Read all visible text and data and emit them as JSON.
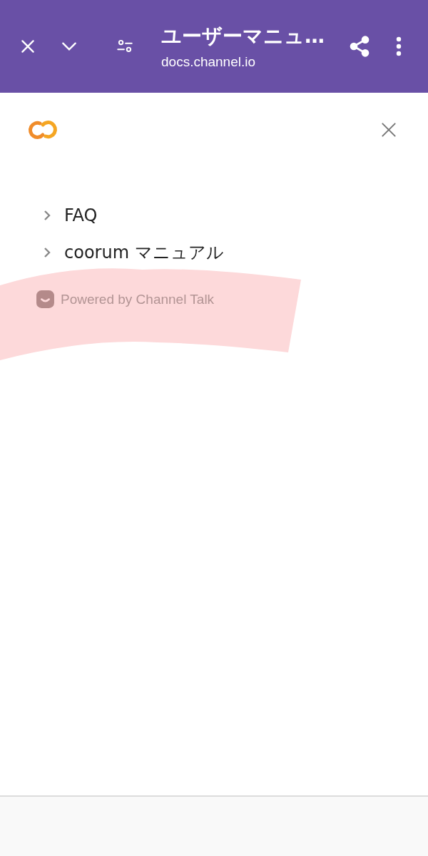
{
  "browser_bar": {
    "title": "ユーザーマニュ…",
    "url": "docs.channel.io"
  },
  "menu": {
    "items": [
      {
        "label": "FAQ",
        "expanded": false
      },
      {
        "label": "coorum マニュアル",
        "expanded": false
      }
    ]
  },
  "footer": {
    "powered_by": "Powered by Channel Talk"
  }
}
